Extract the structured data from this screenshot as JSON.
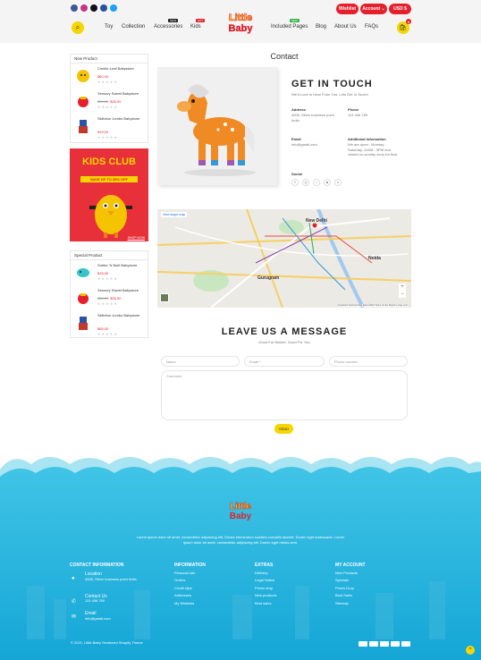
{
  "header": {
    "social": [
      {
        "name": "facebook-icon",
        "color": "#3b5998"
      },
      {
        "name": "instagram-icon",
        "color": "#c13584"
      },
      {
        "name": "tiktok-icon",
        "color": "#111111"
      },
      {
        "name": "snapchat-icon",
        "color": "#2a4fa0"
      },
      {
        "name": "twitter-icon",
        "color": "#1da1f2"
      }
    ],
    "wishlist": "Wishlist",
    "account": "Account ⌄",
    "currency": "USD $",
    "logo_line1": "Little",
    "logo_line2": "Baby",
    "cart_count": "0",
    "nav": [
      {
        "label": "Toy"
      },
      {
        "label": "Collection"
      },
      {
        "label": "Accessories",
        "badge": "NEW",
        "badge_color": "#222"
      },
      {
        "label": "Kids",
        "badge": "HOT",
        "badge_color": "#e4202c"
      },
      {
        "label": "Included Pages",
        "badge": "NEW",
        "badge_color": "#34b34a"
      },
      {
        "label": "Blog"
      },
      {
        "label": "About Us"
      },
      {
        "label": "FAQs"
      }
    ]
  },
  "sidebar": {
    "new_title": "New Product",
    "new_products": [
      {
        "title": "Crinkle-Leaf Babystore",
        "price": "$60.00",
        "old": "",
        "img": "#f5c400"
      },
      {
        "title": "Sensory Sweet Babystore",
        "price": "$25.00",
        "old": "$30.00",
        "img": "#e4202c"
      },
      {
        "title": "Skillofun Jumbo Babystore",
        "price": "$19.00",
        "old": "",
        "img": "#c0392b"
      }
    ],
    "banner_title": "KIDS CLUB",
    "banner_sub": "SAVE UP TO 35% OFF",
    "banner_btn": "SHOP NOW",
    "special_title": "Special Product",
    "special_products": [
      {
        "title": "Sobbe 'N Built Babystore",
        "price": "$15.00",
        "old": "",
        "img": "#36c3c9"
      },
      {
        "title": "Sensory Sweet Babystore",
        "price": "$25.00",
        "old": "$30.00",
        "img": "#e4202c"
      },
      {
        "title": "Skillofun Jumbo Babystore",
        "price": "$65.00",
        "old": "",
        "img": "#c0392b"
      }
    ]
  },
  "contact": {
    "page_title": "Contact",
    "heading": "GET IN TOUCH",
    "sub": "We'd Love to Hear From You, Lets Get In Touch!",
    "address_label": "Address",
    "address": "4005, Silver business point India",
    "phone_label": "Phone",
    "phone": "113 456 789",
    "email_label": "Email",
    "email": "info@gmail.com",
    "info_label": "Additional Information",
    "info": "We are open : Monday - Saturday, 10AM - 5PM and closed on sunday sorry for that.",
    "social_label": "Social",
    "social_icons": [
      "facebook-icon",
      "instagram-icon",
      "tiktok-icon",
      "snapchat-icon",
      "vimeo-icon"
    ],
    "social_glyphs": [
      "f",
      "◎",
      "♪",
      "♣",
      "v"
    ],
    "map_link": "View larger map",
    "map_city1": "New Delhi",
    "map_city2": "Noida",
    "map_city3": "Gurugram",
    "map_footer": "Keyboard shortcuts  Map data ©2022  Terms of Use  Report a map error"
  },
  "form": {
    "title": "LEAVE US A MESSAGE",
    "sub": "-Good For Nature, Good For You-",
    "name_ph": "Name",
    "email_ph": "Email *",
    "phone_ph": "Phone number",
    "comment_ph": "Comment",
    "send": "SEND"
  },
  "footer": {
    "logo_line1": "Little",
    "logo_line2": "Baby",
    "desc": "Lorem ipsum dolor sit amet, consectetur adipiscing elit. Donec elementum sodales convallis laoreet. Donec eget malesuada. Lorem ipsum dolor sit amet, consectetur adipiscing elit. Donec eget metus sem.",
    "contact_title": "CONTACT INFORMATION",
    "loc_label": "Location",
    "loc": "4005, Silver business point India",
    "cu_label": "Contact Us",
    "cu": "113 456 789",
    "em_label": "Email",
    "em": "info@gmail.com",
    "cols": [
      {
        "title": "INFORMATION",
        "links": [
          "Personal info",
          "Orders",
          "Credit slips",
          "Addresses",
          "My Wishlists"
        ]
      },
      {
        "title": "EXTRAS",
        "links": [
          "Delivery",
          "Legal Notice",
          "Prices drop",
          "New products",
          "Best sales"
        ]
      },
      {
        "title": "MY ACCOUNT",
        "links": [
          "New Products",
          "Specials",
          "Prices Drop",
          "Best Sales",
          "Sitemap"
        ]
      }
    ],
    "copyright": "© 2021, Little Baby Sectioned Shopify Theme",
    "payments": [
      "visa",
      "paypal",
      "mastercard",
      "amex",
      "discover"
    ]
  }
}
